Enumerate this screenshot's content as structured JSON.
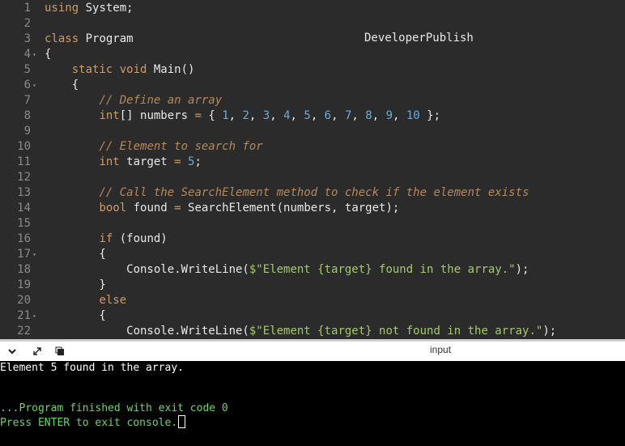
{
  "editor": {
    "watermark": "DeveloperPublish",
    "lines": [
      {
        "n": "1",
        "tokens": [
          {
            "t": "using",
            "c": "kw"
          },
          {
            "t": " System;",
            "c": ""
          }
        ]
      },
      {
        "n": "2",
        "tokens": []
      },
      {
        "n": "3",
        "tokens": [
          {
            "t": "class",
            "c": "kw"
          },
          {
            "t": " Program",
            "c": ""
          }
        ]
      },
      {
        "n": "4",
        "fold": true,
        "tokens": [
          {
            "t": "{",
            "c": ""
          }
        ]
      },
      {
        "n": "5",
        "tokens": [
          {
            "t": "    ",
            "c": ""
          },
          {
            "t": "static",
            "c": "kw"
          },
          {
            "t": " ",
            "c": ""
          },
          {
            "t": "void",
            "c": "kw"
          },
          {
            "t": " Main()",
            "c": ""
          }
        ]
      },
      {
        "n": "6",
        "fold": true,
        "tokens": [
          {
            "t": "    {",
            "c": ""
          }
        ]
      },
      {
        "n": "7",
        "tokens": [
          {
            "t": "        ",
            "c": ""
          },
          {
            "t": "// Define an array",
            "c": "cm"
          }
        ]
      },
      {
        "n": "8",
        "tokens": [
          {
            "t": "        ",
            "c": ""
          },
          {
            "t": "int",
            "c": "kw"
          },
          {
            "t": "[] numbers ",
            "c": ""
          },
          {
            "t": "=",
            "c": "op"
          },
          {
            "t": " { ",
            "c": ""
          },
          {
            "t": "1",
            "c": "nm"
          },
          {
            "t": ", ",
            "c": ""
          },
          {
            "t": "2",
            "c": "nm"
          },
          {
            "t": ", ",
            "c": ""
          },
          {
            "t": "3",
            "c": "nm"
          },
          {
            "t": ", ",
            "c": ""
          },
          {
            "t": "4",
            "c": "nm"
          },
          {
            "t": ", ",
            "c": ""
          },
          {
            "t": "5",
            "c": "nm"
          },
          {
            "t": ", ",
            "c": ""
          },
          {
            "t": "6",
            "c": "nm"
          },
          {
            "t": ", ",
            "c": ""
          },
          {
            "t": "7",
            "c": "nm"
          },
          {
            "t": ", ",
            "c": ""
          },
          {
            "t": "8",
            "c": "nm"
          },
          {
            "t": ", ",
            "c": ""
          },
          {
            "t": "9",
            "c": "nm"
          },
          {
            "t": ", ",
            "c": ""
          },
          {
            "t": "10",
            "c": "nm"
          },
          {
            "t": " };",
            "c": ""
          }
        ]
      },
      {
        "n": "9",
        "tokens": []
      },
      {
        "n": "10",
        "tokens": [
          {
            "t": "        ",
            "c": ""
          },
          {
            "t": "// Element to search for",
            "c": "cm"
          }
        ]
      },
      {
        "n": "11",
        "tokens": [
          {
            "t": "        ",
            "c": ""
          },
          {
            "t": "int",
            "c": "kw"
          },
          {
            "t": " target ",
            "c": ""
          },
          {
            "t": "=",
            "c": "op"
          },
          {
            "t": " ",
            "c": ""
          },
          {
            "t": "5",
            "c": "nm"
          },
          {
            "t": ";",
            "c": ""
          }
        ]
      },
      {
        "n": "12",
        "tokens": []
      },
      {
        "n": "13",
        "tokens": [
          {
            "t": "        ",
            "c": ""
          },
          {
            "t": "// Call the SearchElement method to check if the element exists",
            "c": "cm"
          }
        ]
      },
      {
        "n": "14",
        "tokens": [
          {
            "t": "        ",
            "c": ""
          },
          {
            "t": "bool",
            "c": "kw"
          },
          {
            "t": " found ",
            "c": ""
          },
          {
            "t": "=",
            "c": "op"
          },
          {
            "t": " SearchElement(numbers, target);",
            "c": ""
          }
        ]
      },
      {
        "n": "15",
        "tokens": []
      },
      {
        "n": "16",
        "tokens": [
          {
            "t": "        ",
            "c": ""
          },
          {
            "t": "if",
            "c": "kw"
          },
          {
            "t": " (found)",
            "c": ""
          }
        ]
      },
      {
        "n": "17",
        "fold": true,
        "tokens": [
          {
            "t": "        {",
            "c": ""
          }
        ]
      },
      {
        "n": "18",
        "tokens": [
          {
            "t": "            Console.WriteLine(",
            "c": ""
          },
          {
            "t": "$\"Element {target} found in the array.\"",
            "c": "st"
          },
          {
            "t": ");",
            "c": ""
          }
        ]
      },
      {
        "n": "19",
        "tokens": [
          {
            "t": "        }",
            "c": ""
          }
        ]
      },
      {
        "n": "20",
        "tokens": [
          {
            "t": "        ",
            "c": ""
          },
          {
            "t": "else",
            "c": "kw"
          }
        ]
      },
      {
        "n": "21",
        "fold": true,
        "tokens": [
          {
            "t": "        {",
            "c": ""
          }
        ]
      },
      {
        "n": "22",
        "tokens": [
          {
            "t": "            Console.WriteLine(",
            "c": ""
          },
          {
            "t": "$\"Element {target} not found in the array.\"",
            "c": "st"
          },
          {
            "t": ");",
            "c": ""
          }
        ]
      }
    ]
  },
  "toolbar": {
    "icons": [
      "chevron-down-icon",
      "expand-icon",
      "copy-icon"
    ],
    "input_label": "input"
  },
  "console": {
    "output": "Element 5 found in the array.",
    "finished": "...Program finished with exit code 0",
    "prompt": "Press ENTER to exit console."
  }
}
